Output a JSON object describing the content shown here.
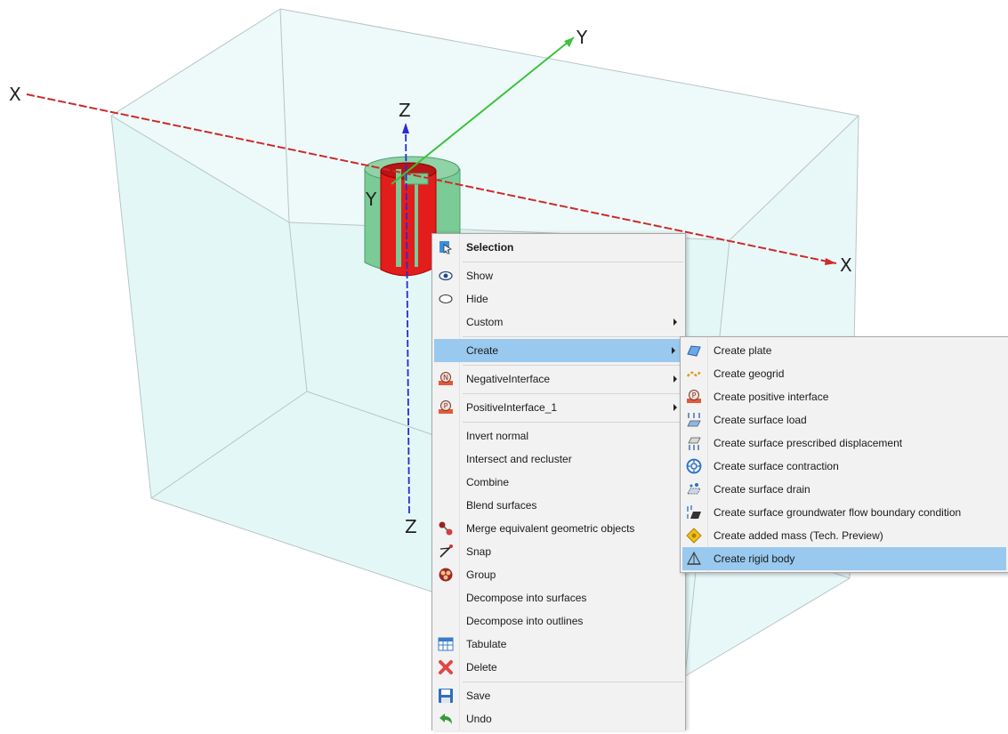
{
  "viewport": {
    "axes": {
      "x_neg": "X",
      "x_pos": "X",
      "y_pos": "Y",
      "y_neg": "Y",
      "z_pos": "Z",
      "z_neg": "Z"
    },
    "colors": {
      "x_axis": "#d42a2a",
      "y_axis": "#2fbf2f",
      "z_axis": "#2a2ad4",
      "box_fill": "#e9f8f8",
      "box_edge": "#b8c2c2",
      "outer_cylinder": "#6cc48c",
      "inner_cylinder": "#e01b1b"
    }
  },
  "context_menu": {
    "items": [
      {
        "label": "Selection",
        "icon": "selection-icon",
        "bold": true
      },
      {
        "label": "Show",
        "icon": "eye-icon"
      },
      {
        "label": "Hide",
        "icon": "hidden-eye-icon"
      },
      {
        "label": "Custom",
        "icon": "",
        "submenu": true
      },
      {
        "label": "Create",
        "icon": "",
        "submenu": true,
        "highlighted": true
      },
      {
        "label": "NegativeInterface",
        "icon": "negative-interface-icon",
        "submenu": true
      },
      {
        "label": "PositiveInterface_1",
        "icon": "positive-interface-icon",
        "submenu": true
      },
      {
        "label": "Invert normal",
        "icon": ""
      },
      {
        "label": "Intersect and recluster",
        "icon": ""
      },
      {
        "label": "Combine",
        "icon": ""
      },
      {
        "label": "Blend surfaces",
        "icon": ""
      },
      {
        "label": "Merge equivalent geometric objects",
        "icon": "merge-icon"
      },
      {
        "label": "Snap",
        "icon": "snap-icon"
      },
      {
        "label": "Group",
        "icon": "group-icon"
      },
      {
        "label": "Decompose into surfaces",
        "icon": ""
      },
      {
        "label": "Decompose into outlines",
        "icon": ""
      },
      {
        "label": "Tabulate",
        "icon": "table-icon"
      },
      {
        "label": "Delete",
        "icon": "delete-icon"
      },
      {
        "label": "Save",
        "icon": "save-icon"
      },
      {
        "label": "Undo",
        "icon": "undo-icon"
      }
    ]
  },
  "create_submenu": {
    "items": [
      {
        "label": "Create plate",
        "icon": "plate-icon"
      },
      {
        "label": "Create geogrid",
        "icon": "geogrid-icon"
      },
      {
        "label": "Create positive interface",
        "icon": "positive-interface-icon"
      },
      {
        "label": "Create surface load",
        "icon": "surface-load-icon"
      },
      {
        "label": "Create surface prescribed displacement",
        "icon": "prescribed-displacement-icon"
      },
      {
        "label": "Create surface contraction",
        "icon": "contraction-icon"
      },
      {
        "label": "Create surface drain",
        "icon": "drain-icon"
      },
      {
        "label": "Create surface groundwater flow boundary condition",
        "icon": "groundwater-flow-icon"
      },
      {
        "label": "Create added mass (Tech. Preview)",
        "icon": "added-mass-icon"
      },
      {
        "label": "Create rigid body",
        "icon": "rigid-body-icon",
        "highlighted": true
      }
    ]
  }
}
